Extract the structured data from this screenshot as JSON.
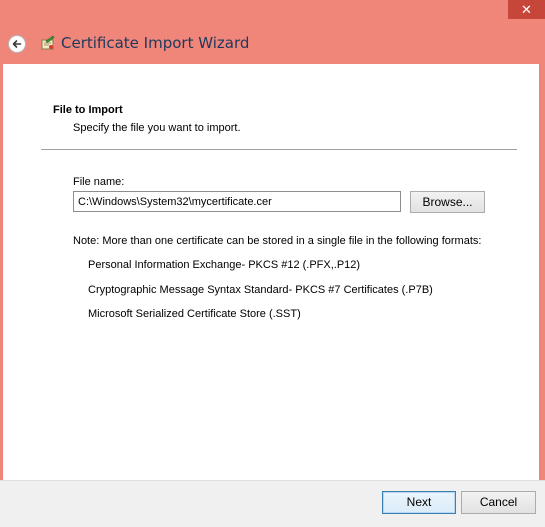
{
  "window": {
    "close_label": "✕",
    "title": "Certificate Import Wizard",
    "frame_color": "#f0857a",
    "title_color": "#1e395b"
  },
  "page": {
    "heading": "File to Import",
    "description": "Specify the file you want to import."
  },
  "file": {
    "label": "File name:",
    "value": "C:\\Windows\\System32\\mycertificate.cer",
    "browse_label": "Browse..."
  },
  "note": "Note:  More than one certificate can be stored in a single file in the following formats:",
  "formats": [
    "Personal Information Exchange- PKCS #12 (.PFX,.P12)",
    "Cryptographic Message Syntax Standard- PKCS #7 Certificates (.P7B)",
    "Microsoft Serialized Certificate Store (.SST)"
  ],
  "buttons": {
    "next": "Next",
    "cancel": "Cancel"
  },
  "icons": {
    "back": "back-arrow-icon",
    "wizard": "certificate-wizard-icon"
  }
}
